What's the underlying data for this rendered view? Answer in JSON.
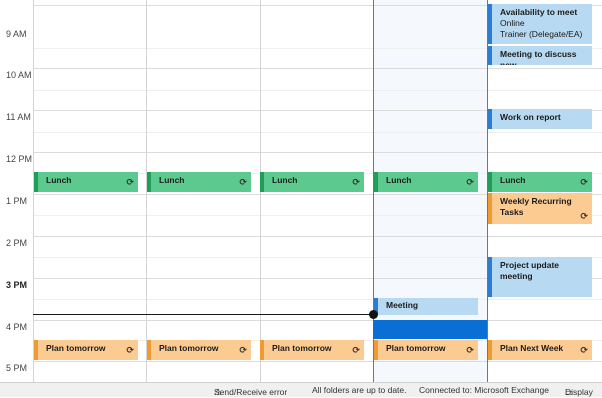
{
  "time_labels": [
    "9 AM",
    "10 AM",
    "11 AM",
    "12 PM",
    "1 PM",
    "2 PM",
    "3 PM",
    "4 PM",
    "5 PM"
  ],
  "current_time_label": "3 PM",
  "events": {
    "lunch": "Lunch",
    "availability": {
      "title": "Availability to meet",
      "location": "Online",
      "organizer": "Trainer (Delegate/EA)"
    },
    "meeting_discuss": "Meeting to discuss new",
    "work_report": "Work on report",
    "weekly_tasks": "Weekly Recurring Tasks",
    "project_update": "Project update meeting",
    "meeting": "Meeting",
    "plan_tomorrow": "Plan tomorrow",
    "plan_next_week": "Plan Next Week"
  },
  "status_bar": {
    "send_receive": "Send/Receive error",
    "folders": "All folders are up to date.",
    "connection": "Connected to: Microsoft Exchange",
    "display": "Display"
  },
  "icons": {
    "recurring": "recurring-icon",
    "warning": "warning-icon",
    "display": "display-settings-icon"
  },
  "colors": {
    "lunch": "#5cc98e",
    "meeting": "#b8d9f2",
    "task": "#fccb91",
    "selection": "#0a6fd4",
    "today_line": "#2b88d8"
  }
}
